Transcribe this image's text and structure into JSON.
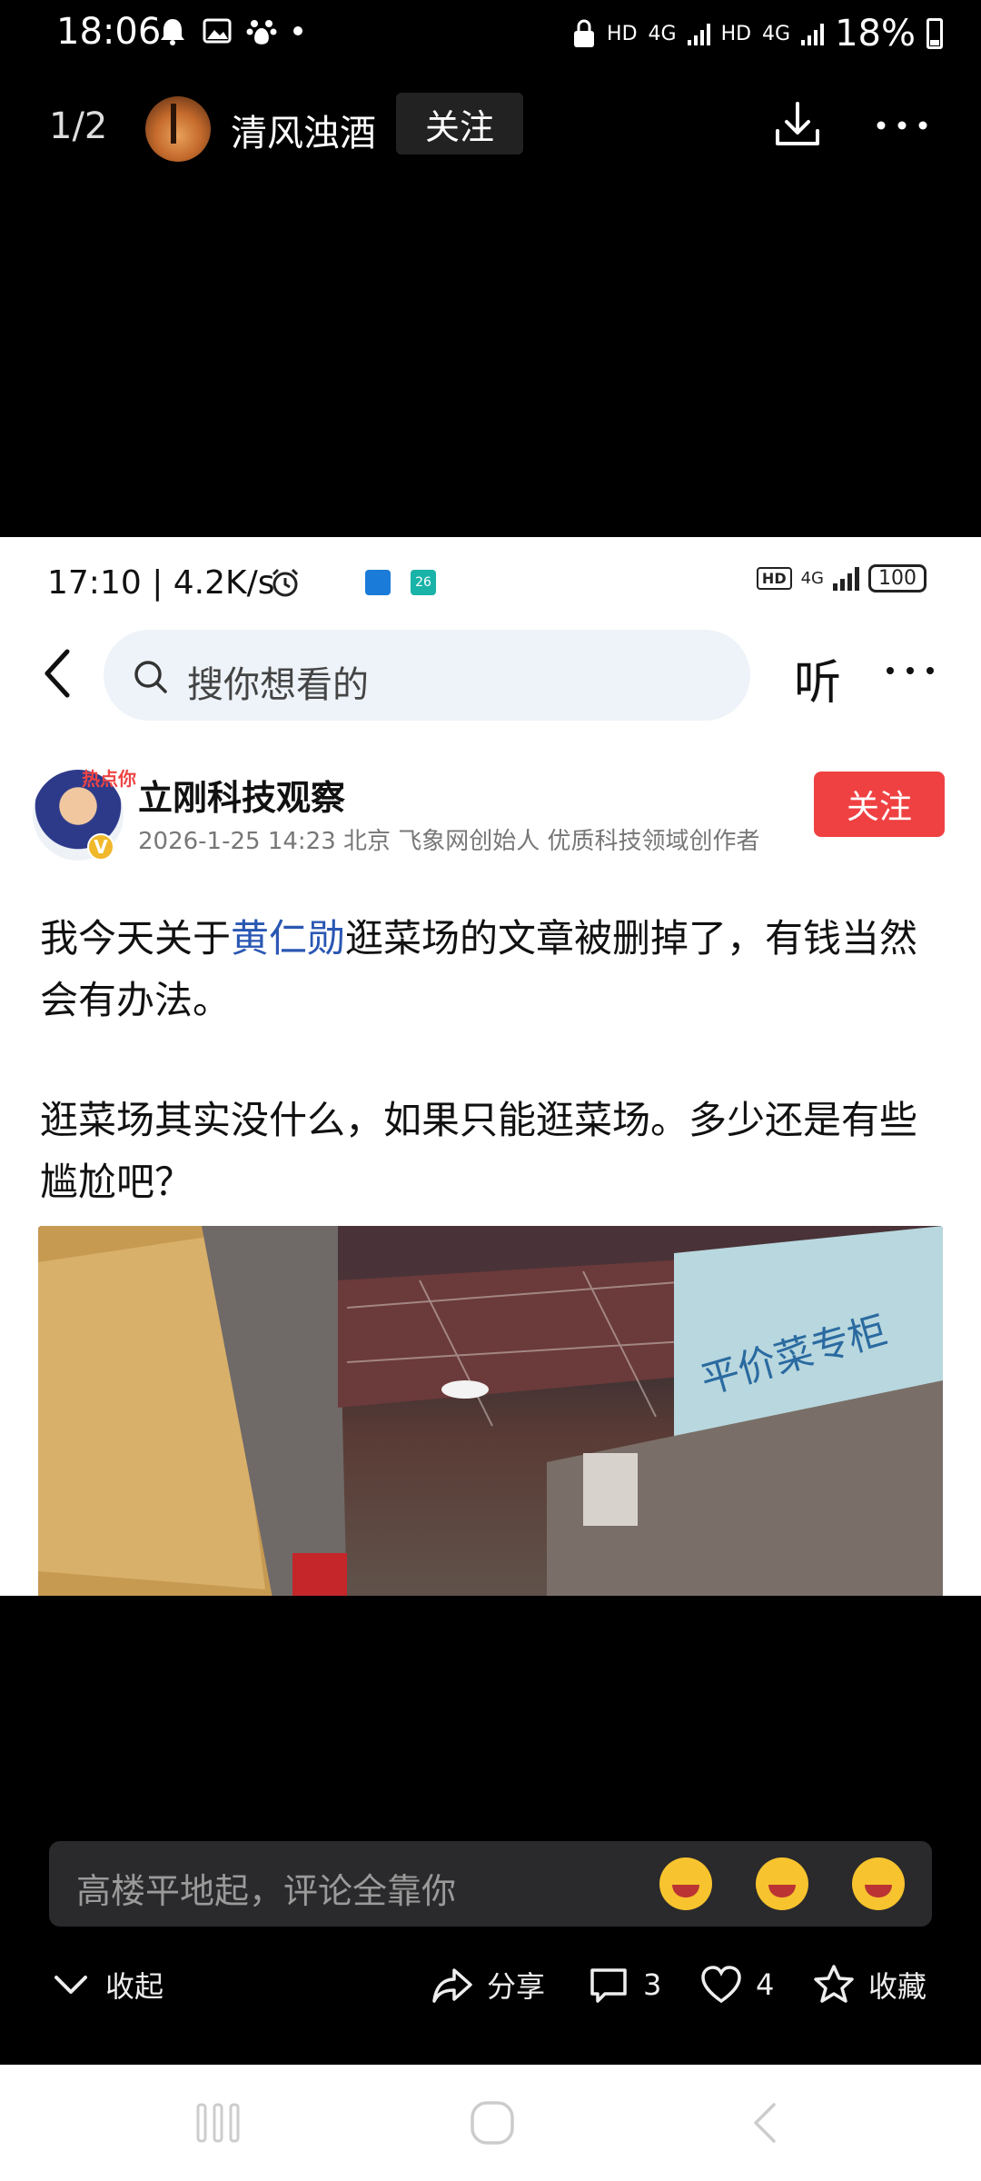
{
  "status_bar": {
    "time": "18:06",
    "battery": "18%",
    "icons": [
      "alarm-icon",
      "image-icon",
      "baidu-paw-icon",
      "dot-icon",
      "lock-icon",
      "hd-icon",
      "4g-icon",
      "signal-icon",
      "battery-icon"
    ],
    "net_label_1": "HD",
    "net_label_2": "4G",
    "net_label_3": "HD",
    "net_label_4": "4G"
  },
  "viewer_header": {
    "page_counter": "1/2",
    "author_name": "清风浊酒",
    "follow_label": "关注"
  },
  "embedded": {
    "status": {
      "time_speed": "17:10 | 4.2K/s",
      "hd": "HD",
      "net": "4G",
      "battery": "100",
      "calendar_day": "26"
    },
    "search": {
      "placeholder": "搜你想看的",
      "listen_label": "听"
    },
    "profile": {
      "name": "立刚科技观察",
      "hot_tag": "热点你",
      "verified_badge": "V",
      "meta": "2026-1-25 14:23  北京  飞象网创始人 优质科技领域创作者",
      "follow_label": "关注"
    },
    "article": {
      "p1_before": "我今天关于",
      "p1_link": "黄仁勋",
      "p1_after": "逛菜场的文章被删掉了，有钱当然会有办法。",
      "p2": "逛菜场其实没什么，如果只能逛菜场。多少还是有些尴尬吧？",
      "photo_sign": "平价菜专柜"
    }
  },
  "comment": {
    "placeholder": "高楼平地起，评论全靠你",
    "emojis": [
      "laughing-emoji",
      "star-eyes-emoji",
      "grinning-emoji"
    ]
  },
  "actions": {
    "collapse": "收起",
    "share": "分享",
    "comments_count": "3",
    "likes_count": "4",
    "favorite": "收藏"
  },
  "colors": {
    "follow_red": "#f04142",
    "link_blue": "#2a57b3",
    "search_bg": "#eef3f9"
  }
}
